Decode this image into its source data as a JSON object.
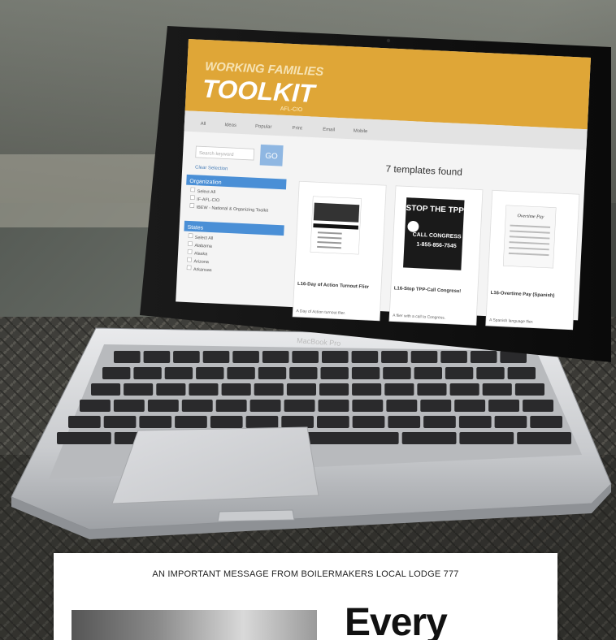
{
  "screen": {
    "banner_line1": "WORKING FAMILIES",
    "banner_line2": "TOOLKIT",
    "banner_sub": "AFL-CIO",
    "nav_items": [
      "All",
      "Ideas",
      "Popular",
      "Print",
      "Email",
      "Mobile"
    ],
    "search_placeholder": "Search keyword",
    "go_label": "GO",
    "filter_reset": "Clear Selection",
    "filter_org_header": "Organization",
    "filter_org_items": [
      "Select All",
      "IF-AFL-CIO",
      "IBEW - National & Organizing Toolkit"
    ],
    "filter_state_header": "States",
    "filter_state_items": [
      "Select All",
      "Alabama",
      "Alaska",
      "Arizona",
      "Arkansas"
    ],
    "results_heading": "7 templates found",
    "cards": [
      {
        "title": "L16-Day of Action Turnout Flier",
        "desc": "A Day of Action turnout flier."
      },
      {
        "title": "L16-Stop TPP-Call Congress!",
        "desc": "A flier with a call to Congress."
      },
      {
        "title": "L16-Overtime Pay (Spanish)",
        "desc": "A Spanish language flier."
      }
    ],
    "card2_poster_line1": "STOP THE TPP",
    "card2_poster_line2": "CALL CONGRESS",
    "card2_poster_line3": "1-855-856-7545",
    "card3_poster": "Overtime Pay",
    "laptop_brand": "MacBook Pro"
  },
  "panel": {
    "heading": "AN IMPORTANT MESSAGE FROM BOILERMAKERS LOCAL LODGE 777",
    "headline_word": "Every"
  },
  "colors": {
    "banner": "#dfa637",
    "accent_blue": "#4a8fd6",
    "panel_bg": "#ffffff"
  }
}
